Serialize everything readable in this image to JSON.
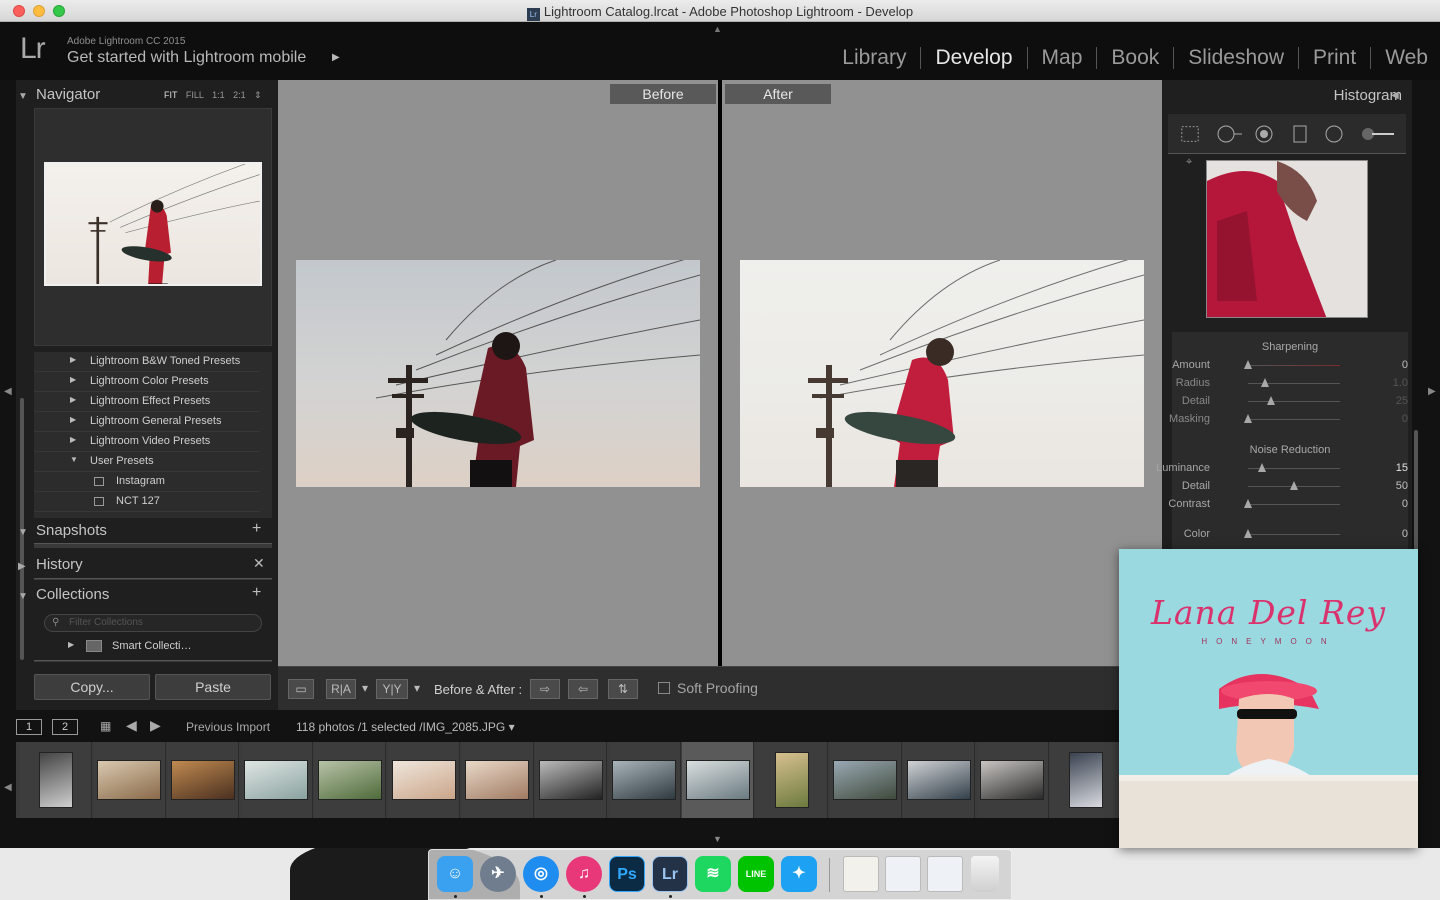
{
  "window": {
    "title": "Lightroom Catalog.lrcat - Adobe Photoshop Lightroom - Develop",
    "title_icon": "Lr"
  },
  "identity": {
    "logo": "Lr",
    "product": "Adobe Lightroom CC 2015",
    "mobile_prompt": "Get started with Lightroom mobile"
  },
  "modules": [
    "Library",
    "Develop",
    "Map",
    "Book",
    "Slideshow",
    "Print",
    "Web"
  ],
  "active_module": "Develop",
  "left_panel": {
    "navigator": {
      "title": "Navigator",
      "zooms": {
        "fit": "FIT",
        "fill": "FILL",
        "one": "1:1",
        "two": "2:1"
      }
    },
    "presets": [
      {
        "label": "Lightroom B&W Toned Presets",
        "expanded": false
      },
      {
        "label": "Lightroom Color Presets",
        "expanded": false
      },
      {
        "label": "Lightroom Effect Presets",
        "expanded": false
      },
      {
        "label": "Lightroom General Presets",
        "expanded": false
      },
      {
        "label": "Lightroom Video Presets",
        "expanded": false
      },
      {
        "label": "User Presets",
        "expanded": true
      },
      {
        "label": "Instagram",
        "child": true
      },
      {
        "label": "NCT 127",
        "child": true
      }
    ],
    "snapshots": "Snapshots",
    "history": "History",
    "collections": {
      "title": "Collections",
      "filter_placeholder": "Filter Collections",
      "smart": "Smart Collecti…"
    },
    "copy_label": "Copy...",
    "paste_label": "Paste"
  },
  "center": {
    "before_label": "Before",
    "after_label": "After"
  },
  "toolbar": {
    "ra_label": "R|A",
    "yy_label": "Y|Y",
    "before_after_label": "Before & After :",
    "soft_proofing_label": "Soft Proofing"
  },
  "right_panel": {
    "histogram_title": "Histogram",
    "sharpening": {
      "title": "Sharpening",
      "rows": [
        {
          "label": "Amount",
          "value": "0",
          "pos": 0.0,
          "dim": false
        },
        {
          "label": "Radius",
          "value": "1.0",
          "pos": 0.18,
          "dim": true
        },
        {
          "label": "Detail",
          "value": "25",
          "pos": 0.25,
          "dim": true
        },
        {
          "label": "Masking",
          "value": "0",
          "pos": 0.0,
          "dim": true
        }
      ]
    },
    "noise": {
      "title": "Noise Reduction",
      "rows": [
        {
          "label": "Luminance",
          "value": "15",
          "pos": 0.15,
          "hi": true
        },
        {
          "label": "Detail",
          "value": "50",
          "pos": 0.5
        },
        {
          "label": "Contrast",
          "value": "0",
          "pos": 0.0
        }
      ]
    },
    "color": {
      "label": "Color",
      "value": "0",
      "pos": 0.0
    }
  },
  "filmstrip": {
    "view1": "1",
    "view2": "2",
    "source": "Previous Import",
    "status_prefix": "118 photos /1 selected /",
    "selected_file": "IMG_2085.JPG",
    "thumbnails": [
      {
        "orientation": "portrait",
        "colors": [
          "#cfcfcf",
          "#444"
        ]
      },
      {
        "orientation": "landscape",
        "colors": [
          "#8a6a4a",
          "#d9c9b0"
        ]
      },
      {
        "orientation": "landscape",
        "colors": [
          "#4a3020",
          "#c08a50"
        ]
      },
      {
        "orientation": "landscape",
        "colors": [
          "#8aa2a0",
          "#dfe6e3"
        ]
      },
      {
        "orientation": "landscape",
        "colors": [
          "#4f6b3a",
          "#b8c3a8"
        ]
      },
      {
        "orientation": "landscape",
        "colors": [
          "#caa589",
          "#efe6dc"
        ]
      },
      {
        "orientation": "landscape",
        "colors": [
          "#a07a62",
          "#e9d9c8"
        ]
      },
      {
        "orientation": "landscape",
        "colors": [
          "#222",
          "#bbb"
        ]
      },
      {
        "orientation": "landscape",
        "colors": [
          "#2f3a40",
          "#a9b5bb"
        ]
      },
      {
        "orientation": "landscape",
        "colors": [
          "#6a7a80",
          "#dadfe0"
        ]
      },
      {
        "orientation": "portrait",
        "colors": [
          "#6c7a3e",
          "#d7c08f"
        ]
      },
      {
        "orientation": "landscape",
        "colors": [
          "#3f4a3c",
          "#9aa9b4"
        ]
      },
      {
        "orientation": "landscape",
        "colors": [
          "#33404a",
          "#d0d3d6"
        ]
      },
      {
        "orientation": "landscape",
        "colors": [
          "#2a2a2a",
          "#c9c6c2"
        ]
      },
      {
        "orientation": "portrait",
        "colors": [
          "#d9dbe0",
          "#3a4250"
        ]
      }
    ]
  },
  "mini_player": {
    "artist": "Lana Del Rey",
    "album": "HONEYMOON"
  },
  "dock": {
    "apps": [
      {
        "name": "finder-icon",
        "glyph": "☺",
        "color": "#3aa1f0",
        "running": true
      },
      {
        "name": "launchpad-icon",
        "glyph": "✈",
        "color": "#6f7d8f",
        "running": false
      },
      {
        "name": "safari-icon",
        "glyph": "◎",
        "color": "#1f8df0",
        "running": true
      },
      {
        "name": "itunes-icon",
        "glyph": "♫",
        "color": "#e8387a",
        "running": true
      },
      {
        "name": "photoshop-icon",
        "glyph": "Ps",
        "color": "#0b2a44",
        "running": false
      },
      {
        "name": "lightroom-icon",
        "glyph": "Lr",
        "color": "#243247",
        "running": true
      },
      {
        "name": "spotify-icon",
        "glyph": "≋",
        "color": "#1ed760",
        "running": false
      },
      {
        "name": "line-icon",
        "glyph": "LINE",
        "color": "#00c300",
        "running": false
      },
      {
        "name": "twitter-icon",
        "glyph": "✦",
        "color": "#1da1f2",
        "running": false
      }
    ],
    "trash": "trash-icon"
  },
  "colors": {
    "panel_bg": "#1f1f1f",
    "center_bg": "#919191",
    "accent_red": "#c11d3c"
  }
}
